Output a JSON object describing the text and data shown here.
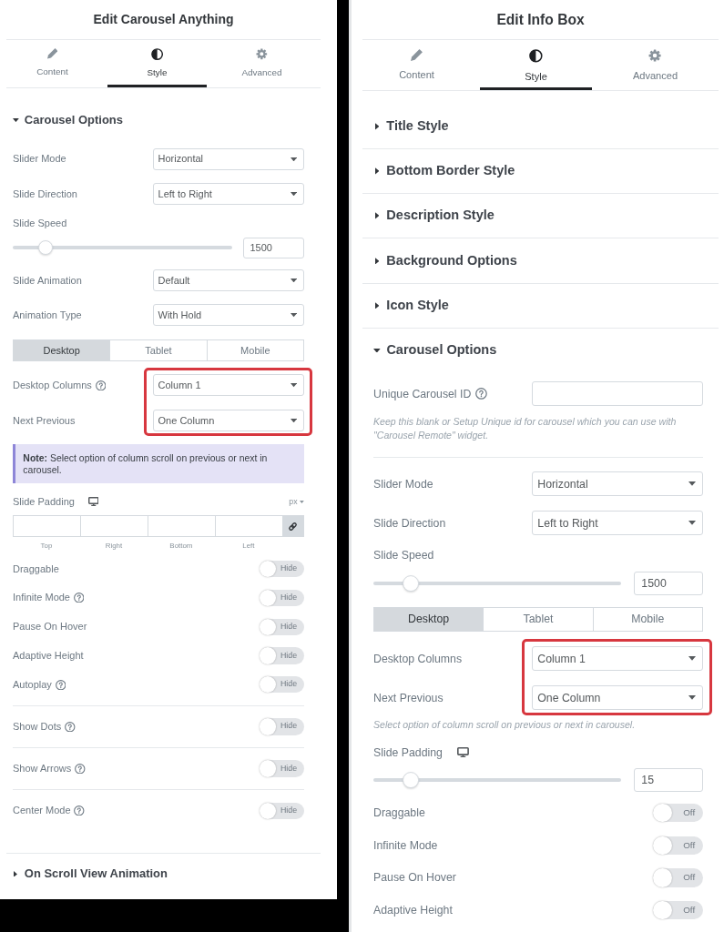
{
  "panels": [
    {
      "title": "Edit Carousel Anything",
      "tabs": [
        {
          "label": "Content",
          "selected": false
        },
        {
          "label": "Style",
          "selected": true
        },
        {
          "label": "Advanced",
          "selected": false
        }
      ],
      "sections": [
        {
          "title": "Carousel Options",
          "expanded": true,
          "groups": [
            [
              {
                "kind": "select",
                "label": "Slider Mode",
                "help": false,
                "value": "Horizontal"
              },
              {
                "kind": "select",
                "label": "Slide Direction",
                "help": false,
                "value": "Left to Right"
              },
              {
                "kind": "slider",
                "label": "Slide Speed",
                "responsive": false,
                "level": 0.15,
                "value": "1500"
              },
              {
                "kind": "select",
                "label": "Slide Animation",
                "help": false,
                "value": "Default"
              },
              {
                "kind": "select",
                "label": "Animation Type",
                "help": false,
                "value": "With Hold"
              },
              {
                "kind": "devices",
                "tabs": [
                  {
                    "label": "Desktop",
                    "selected": true
                  },
                  {
                    "label": "Tablet",
                    "selected": false
                  },
                  {
                    "label": "Mobile",
                    "selected": false
                  }
                ]
              },
              {
                "kind": "highlight",
                "controls": [
                  {
                    "kind": "select",
                    "label": "Desktop Columns",
                    "help": true,
                    "value": "Column 1"
                  },
                  {
                    "kind": "select",
                    "label": "Next Previous",
                    "help": false,
                    "value": "One Column"
                  }
                ]
              },
              {
                "kind": "note",
                "text": "**Note:** Select option of column scroll on previous or next in carousel."
              },
              {
                "kind": "dimensions",
                "label": "Slide Padding",
                "responsive": true,
                "unit": "px",
                "sides": [
                  "Top",
                  "Right",
                  "Bottom",
                  "Left"
                ]
              },
              {
                "kind": "toggle",
                "label": "Draggable",
                "help": false,
                "on": false,
                "text": "Hide"
              },
              {
                "kind": "toggle",
                "label": "Infinite Mode",
                "help": true,
                "on": false,
                "text": "Hide"
              },
              {
                "kind": "toggle",
                "label": "Pause On Hover",
                "help": false,
                "on": false,
                "text": "Hide"
              },
              {
                "kind": "toggle",
                "label": "Adaptive Height",
                "help": false,
                "on": false,
                "text": "Hide"
              },
              {
                "kind": "toggle",
                "label": "Autoplay",
                "help": true,
                "on": false,
                "text": "Hide"
              }
            ],
            [
              {
                "kind": "toggle",
                "label": "Show Dots",
                "help": true,
                "on": false,
                "text": "Hide"
              }
            ],
            [
              {
                "kind": "toggle",
                "label": "Show Arrows",
                "help": true,
                "on": false,
                "text": "Hide"
              }
            ],
            [
              {
                "kind": "toggle",
                "label": "Center Mode",
                "help": true,
                "on": false,
                "text": "Hide"
              }
            ]
          ]
        },
        {
          "title": "On Scroll View Animation",
          "expanded": false
        }
      ]
    },
    {
      "title": "Edit Info Box",
      "tabs": [
        {
          "label": "Content",
          "selected": false
        },
        {
          "label": "Style",
          "selected": true
        },
        {
          "label": "Advanced",
          "selected": false
        }
      ],
      "sections": [
        {
          "title": "Title Style",
          "expanded": false
        },
        {
          "title": "Bottom Border Style",
          "expanded": false
        },
        {
          "title": "Description Style",
          "expanded": false
        },
        {
          "title": "Background Options",
          "expanded": false
        },
        {
          "title": "Icon Style",
          "expanded": false
        },
        {
          "title": "Carousel Options",
          "expanded": true,
          "groups": [
            [
              {
                "kind": "text_input",
                "label": "Unique Carousel ID",
                "help": true
              },
              {
                "kind": "help_text",
                "text": "Keep this blank or Setup Unique id for carousel which you can use with \"Carousel Remote\" widget."
              }
            ],
            [
              {
                "kind": "select",
                "label": "Slider Mode",
                "help": false,
                "value": "Horizontal"
              },
              {
                "kind": "select",
                "label": "Slide Direction",
                "help": false,
                "value": "Left to Right"
              },
              {
                "kind": "slider",
                "label": "Slide Speed",
                "responsive": false,
                "level": 0.15,
                "value": "1500"
              },
              {
                "kind": "devices",
                "tabs": [
                  {
                    "label": "Desktop",
                    "selected": true
                  },
                  {
                    "label": "Tablet",
                    "selected": false
                  },
                  {
                    "label": "Mobile",
                    "selected": false
                  }
                ]
              },
              {
                "kind": "highlight",
                "controls": [
                  {
                    "kind": "select",
                    "label": "Desktop Columns",
                    "help": false,
                    "value": "Column 1"
                  },
                  {
                    "kind": "select",
                    "label": "Next Previous",
                    "help": false,
                    "value": "One Column"
                  }
                ]
              },
              {
                "kind": "help_text",
                "text": "Select option of column scroll on previous or next in carousel."
              },
              {
                "kind": "slider",
                "label": "Slide Padding",
                "responsive": true,
                "level": 0.15,
                "value": "15"
              },
              {
                "kind": "toggle",
                "label": "Draggable",
                "help": false,
                "on": false,
                "text": "Off"
              },
              {
                "kind": "toggle",
                "label": "Infinite Mode",
                "help": false,
                "on": false,
                "text": "Off"
              },
              {
                "kind": "toggle",
                "label": "Pause On Hover",
                "help": false,
                "on": false,
                "text": "Off"
              },
              {
                "kind": "toggle",
                "label": "Adaptive Height",
                "help": false,
                "on": false,
                "text": "Off"
              }
            ]
          ]
        }
      ]
    }
  ]
}
